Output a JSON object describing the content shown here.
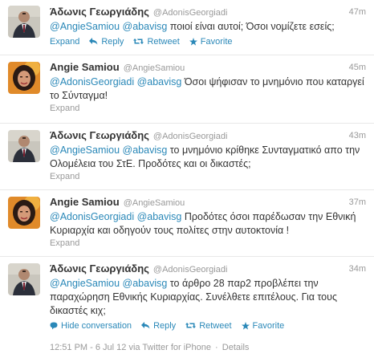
{
  "tweets": [
    {
      "fullname": "Άδωνις Γεωργιάδης",
      "username": "@AdonisGeorgiadi",
      "time": "47m",
      "mention1": "@AngieSamiou",
      "mention2": "@abavisg",
      "text": " ποιοί είναι αυτοί; Όσοι νομίζετε εσείς;",
      "expand": "Expand",
      "reply": "Reply",
      "retweet": "Retweet",
      "favorite": "Favorite"
    },
    {
      "fullname": "Angie Samiou",
      "username": "@AngieSamiou",
      "time": "45m",
      "mention1": "@AdonisGeorgiadi",
      "mention2": "@abavisg",
      "text": " Όσοι ψήφισαν το μνημόνιο που καταργεί το Σύνταγμα!",
      "expand": "Expand"
    },
    {
      "fullname": "Άδωνις Γεωργιάδης",
      "username": "@AdonisGeorgiadi",
      "time": "43m",
      "mention1": "@AngieSamiou",
      "mention2": "@abavisg",
      "text": " το μνημόνιο κρίθηκε Συνταγματικό απο την Ολομέλεια του ΣτΕ. Προδότες και οι δικαστές;",
      "expand": "Expand"
    },
    {
      "fullname": "Angie Samiou",
      "username": "@AngieSamiou",
      "time": "37m",
      "mention1": "@AdonisGeorgiadi",
      "mention2": "@abavisg",
      "text": " Προδότες όσοι παρέδωσαν την Εθνική Κυριαρχία και οδηγούν τους πολίτες στην αυτοκτονία !",
      "expand": "Expand"
    },
    {
      "fullname": "Άδωνις Γεωργιάδης",
      "username": "@AdonisGeorgiadi",
      "time": "34m",
      "mention1": "@AngieSamiou",
      "mention2": "@abavisg",
      "text": " το άρθρο 28 παρ2 προβλέπει την παραχώρηση Εθνικής Κυριαρχίας. Συνέλθετε επιτέλους. Για τους δικαστές κιχ;",
      "hide_conversation": "Hide conversation",
      "reply": "Reply",
      "retweet": "Retweet",
      "favorite": "Favorite",
      "meta_time": "12:51 PM - 6 Jul 12",
      "meta_via": "via Twitter for iPhone",
      "meta_details": "Details"
    }
  ],
  "colors": {
    "link": "#2a88b8",
    "muted": "#999999",
    "text": "#333333"
  }
}
